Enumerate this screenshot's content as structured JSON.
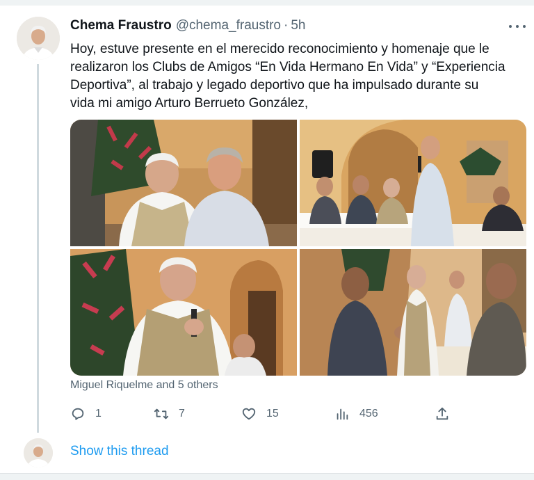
{
  "tweet": {
    "author_name": "Chema Fraustro",
    "author_handle": "@chema_fraustro",
    "separator": "·",
    "time": "5h",
    "text_lines": [
      "Hoy, estuve presente en el merecido reconocimiento y homenaje que le",
      "realizaron los Clubs de Amigos “En Vida Hermano En Vida” y “Experiencia",
      "Deportiva”, al trabajo y legado deportivo que ha impulsado durante su",
      "vida mi amigo Arturo Berrueto González,"
    ],
    "liked_by": "Miguel Riquelme and 5 others",
    "media_count": 4,
    "icons": {
      "more": "more-horizontal-icon",
      "reply": "reply-icon",
      "retweet": "retweet-icon",
      "like": "heart-icon",
      "views": "analytics-icon",
      "share": "share-icon"
    }
  },
  "actions": {
    "replies": "1",
    "retweets": "7",
    "likes": "15",
    "views": "456"
  },
  "thread": {
    "show_label": "Show this thread"
  },
  "colors": {
    "accent": "#1d9bf0",
    "text_primary": "#0f1419",
    "text_secondary": "#536471",
    "thread_line": "#cfd9de"
  }
}
